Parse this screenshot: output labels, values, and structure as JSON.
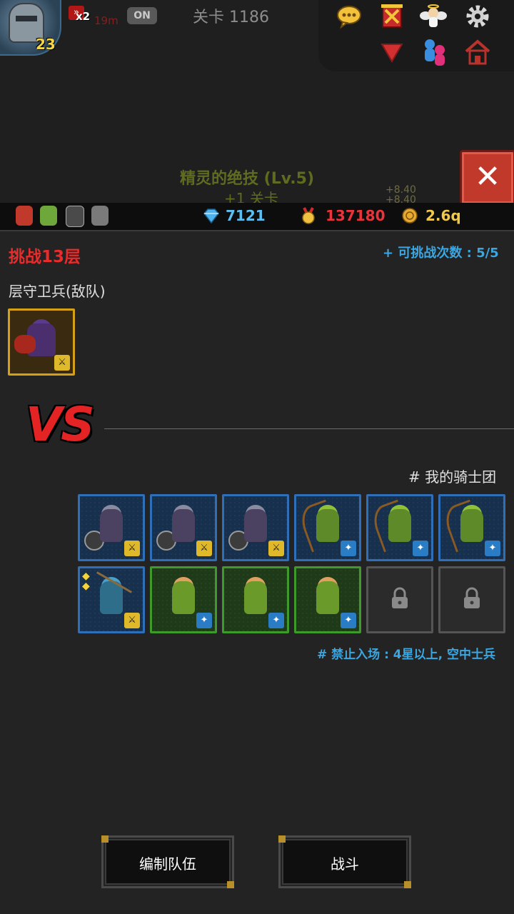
{
  "hud": {
    "player_level": "23",
    "speed_multiplier": "x2",
    "speed_time": "19m",
    "auto_toggle": "ON",
    "stage_title": "关卡 1186",
    "skill_name": "精灵的绝技 (Lv.5)",
    "skill_sub": "+1 关卡",
    "floating_1": "+8.40",
    "floating_2": "+8.40",
    "top_icons": [
      "chat-icon",
      "guild-banner-icon",
      "angel-icon",
      "gear-icon",
      "dropdown-arrow-icon",
      "friends-icon",
      "house-icon"
    ]
  },
  "resources": {
    "gems": "7121",
    "medals": "137180",
    "gold": "2.6q"
  },
  "challenge": {
    "title": "挑战13层",
    "attempts": "+ 可挑战次数 : 5/5",
    "enemy_label": "层守卫兵(敌队)",
    "vs": "VS",
    "my_team_label": "# 我的骑士团",
    "restriction": "# 禁止入场 : 4星以上, 空中士兵"
  },
  "enemy_team": [
    {
      "type": "hooded-assassin",
      "badge": "sword"
    }
  ],
  "my_team": [
    {
      "type": "dark-knight-flail",
      "frame": "blue",
      "badge": "sword"
    },
    {
      "type": "dark-knight-flail",
      "frame": "blue",
      "badge": "sword"
    },
    {
      "type": "dark-knight-flail",
      "frame": "blue",
      "badge": "sword"
    },
    {
      "type": "elf-archer",
      "frame": "blue",
      "badge": "staff"
    },
    {
      "type": "elf-archer",
      "frame": "blue",
      "badge": "staff"
    },
    {
      "type": "elf-archer",
      "frame": "blue",
      "badge": "staff"
    },
    {
      "type": "goblin-spearman",
      "frame": "blue",
      "badge": "sword",
      "stars": 2
    },
    {
      "type": "forest-elf",
      "frame": "green",
      "badge": "staff"
    },
    {
      "type": "forest-elf",
      "frame": "green",
      "badge": "staff"
    },
    {
      "type": "forest-elf",
      "frame": "green",
      "badge": "staff"
    },
    {
      "type": "locked",
      "frame": "locked"
    },
    {
      "type": "locked",
      "frame": "locked"
    }
  ],
  "buttons": {
    "edit_team": "编制队伍",
    "battle": "战斗"
  },
  "colors": {
    "accent_red": "#e82b2b",
    "accent_blue": "#3ba6e0",
    "medal_red": "#e8343a",
    "gold_yellow": "#f0c84a",
    "gem_blue": "#5bc0f0"
  }
}
